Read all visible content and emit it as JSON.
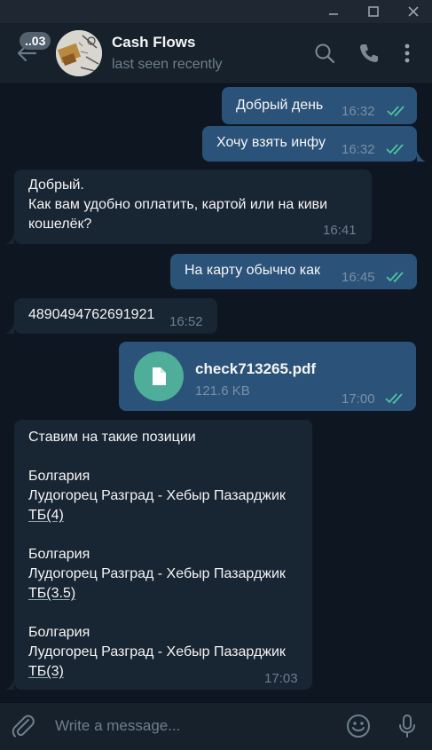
{
  "header": {
    "unread_badge": "..03",
    "name": "Cash Flows",
    "status": "last seen recently"
  },
  "messages": [
    {
      "dir": "out",
      "text": "Добрый день",
      "time": "16:32",
      "read": true
    },
    {
      "dir": "out",
      "text": "Хочу взять инфу",
      "time": "16:32",
      "read": true
    },
    {
      "dir": "in",
      "lines": [
        "Добрый.",
        "Как вам удобно оплатить, картой или на киви",
        "кошелёк?"
      ],
      "time": "16:41"
    },
    {
      "dir": "out",
      "text": "На карту обычно как",
      "time": "16:45",
      "read": true
    },
    {
      "dir": "in",
      "text": "4890494762691921",
      "time": "16:52"
    },
    {
      "dir": "out",
      "file": {
        "name": "check713265.pdf",
        "size": "121.6 KB"
      },
      "time": "17:00",
      "read": true
    },
    {
      "dir": "in",
      "lines": [
        "Ставим на такие позиции",
        "",
        "Болгария",
        "Лудогорец Разград - Хебыр Пазарджик",
        "ТБ(4)",
        "",
        "Болгария",
        "Лудогорец Разград - Хебыр Пазарджик",
        "ТБ(3.5)",
        "",
        "Болгария",
        "Лудогорец Разград - Хебыр Пазарджик",
        "ТБ(3)"
      ],
      "time": "17:03"
    }
  ],
  "composer": {
    "placeholder": "Write a message..."
  },
  "colors": {
    "accent": "#4fae9a",
    "outgoing_bubble": "#2b5278",
    "incoming_bubble": "#182533",
    "read_ticks": "#4fc3a1"
  },
  "icons": [
    "minimize-icon",
    "maximize-icon",
    "close-icon",
    "back-arrow-icon",
    "search-icon",
    "phone-icon",
    "more-vert-icon",
    "file-icon",
    "double-check-icon",
    "attach-icon",
    "emoji-icon",
    "microphone-icon"
  ]
}
